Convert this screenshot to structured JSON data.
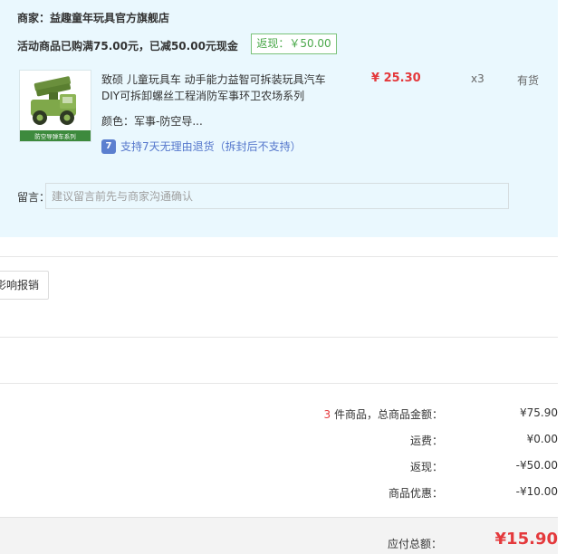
{
  "shop": {
    "name": "商家：益趣童年玩具官方旗舰店",
    "promo_text": "活动商品已购满75.00元，已减50.00元现金",
    "promo_badge": "返现：￥50.00"
  },
  "product": {
    "title": "致硕 儿童玩具车 动手能力益智可拆装玩具汽车 DIY可拆卸螺丝工程消防军事环卫农场系列",
    "price": "¥ 25.30",
    "quantity": "x3",
    "stock": "有货",
    "color": "颜色：军事-防空导...",
    "return_icon_label": "7",
    "return_policy": "支持7天无理由退货（拆封后不支持）",
    "image_caption": "防空导弹车系列"
  },
  "note": {
    "label": "留言：",
    "placeholder": "建议留言前先与商家沟通确认"
  },
  "invoice": {
    "button_label": "影响报销"
  },
  "summary": {
    "count": "3",
    "count_suffix": " 件商品，总商品金额：",
    "goods_total": "¥75.90",
    "shipping_label": "运费：",
    "shipping_value": "¥0.00",
    "cashback_label": "返现：",
    "cashback_value": "-¥50.00",
    "discount_label": "商品优惠：",
    "discount_value": "-¥10.00",
    "payable_label": "应付总额：",
    "payable_value": "¥15.90"
  },
  "colors": {
    "accent_red": "#e4393c",
    "shop_bg": "#eaf8fe",
    "promo_green": "#4aa84a",
    "link_blue": "#5577cc"
  }
}
